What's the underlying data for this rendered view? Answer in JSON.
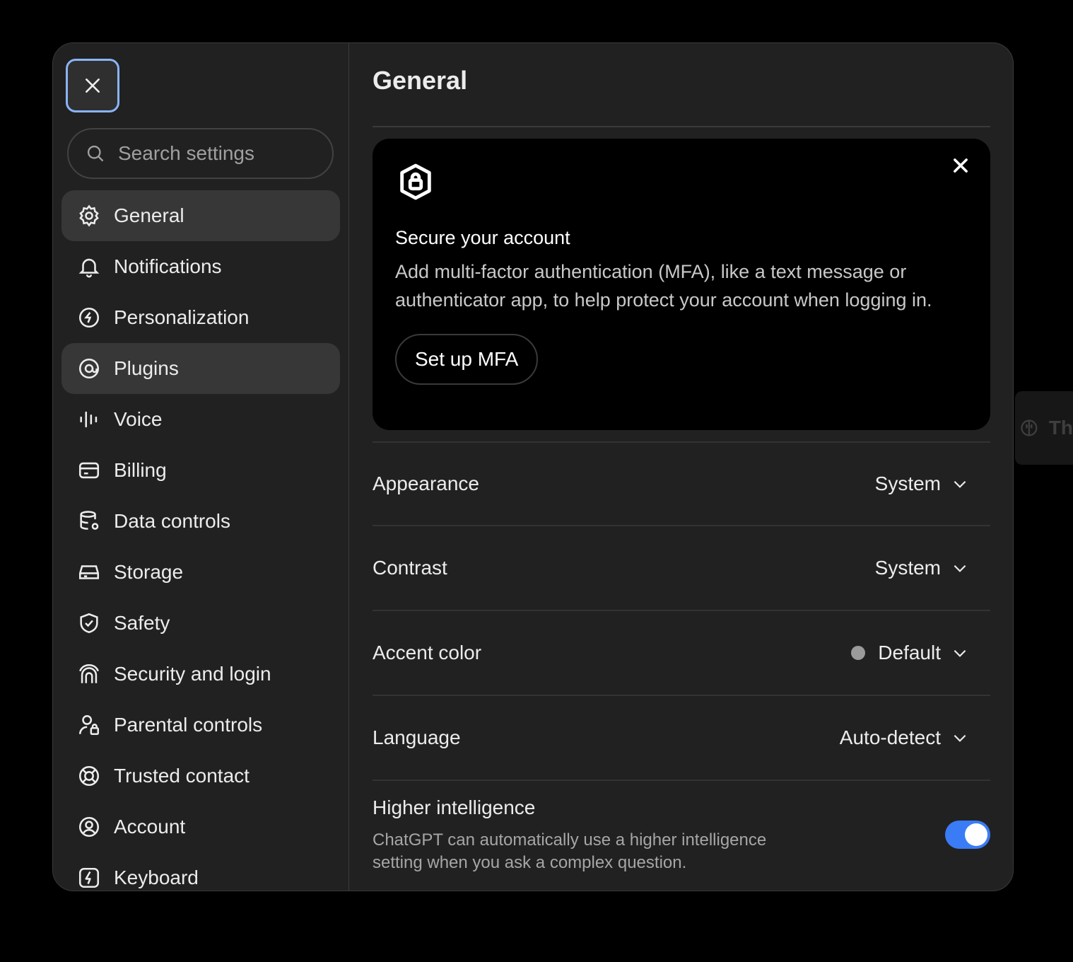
{
  "search": {
    "placeholder": "Search settings"
  },
  "sidebar": {
    "items": [
      {
        "label": "General",
        "icon": "gear-icon"
      },
      {
        "label": "Notifications",
        "icon": "bell-icon"
      },
      {
        "label": "Personalization",
        "icon": "personalization-icon"
      },
      {
        "label": "Plugins",
        "icon": "plugins-icon"
      },
      {
        "label": "Voice",
        "icon": "voice-waveform-icon"
      },
      {
        "label": "Billing",
        "icon": "credit-card-icon"
      },
      {
        "label": "Data controls",
        "icon": "database-gear-icon"
      },
      {
        "label": "Storage",
        "icon": "storage-drive-icon"
      },
      {
        "label": "Safety",
        "icon": "shield-check-icon"
      },
      {
        "label": "Security and login",
        "icon": "security-login-icon"
      },
      {
        "label": "Parental controls",
        "icon": "parental-lock-icon"
      },
      {
        "label": "Trusted contact",
        "icon": "lifebuoy-icon"
      },
      {
        "label": "Account",
        "icon": "user-circle-icon"
      },
      {
        "label": "Keyboard",
        "icon": "keyboard-bolt-icon"
      }
    ]
  },
  "main": {
    "title": "General",
    "mfa": {
      "title": "Secure your account",
      "description": "Add multi-factor authentication (MFA), like a text message or authenticator app, to help protect your account when logging in.",
      "button": "Set up MFA"
    },
    "settings": [
      {
        "label": "Appearance",
        "value": "System"
      },
      {
        "label": "Contrast",
        "value": "System"
      },
      {
        "label": "Accent color",
        "value": "Default"
      },
      {
        "label": "Language",
        "value": "Auto-detect"
      }
    ],
    "higher_intelligence": {
      "title": "Higher intelligence",
      "description": "ChatGPT can automatically use a higher intelligence setting when you ask a complex question.",
      "enabled": true
    }
  },
  "colors": {
    "accent": "#3a7cf5",
    "focus_ring": "#8ab4f8",
    "accent_dot": "#9b9b9b"
  }
}
